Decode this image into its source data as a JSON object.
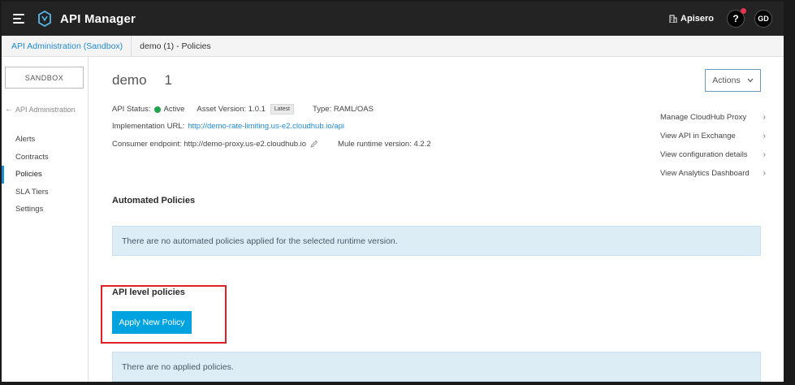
{
  "app": {
    "title": "API Manager",
    "org_name": "Apisero",
    "help_label": "?",
    "user_initials": "GD"
  },
  "breadcrumb": {
    "parent": "API Administration (Sandbox)",
    "current": "demo (1) - Policies"
  },
  "sidebar": {
    "environment": "SANDBOX",
    "back_label": "API Administration",
    "items": [
      {
        "label": "Alerts",
        "active": false
      },
      {
        "label": "Contracts",
        "active": false
      },
      {
        "label": "Policies",
        "active": true
      },
      {
        "label": "SLA Tiers",
        "active": false
      },
      {
        "label": "Settings",
        "active": false
      }
    ]
  },
  "api": {
    "name": "demo",
    "version": "1",
    "actions_label": "Actions",
    "status_label": "API Status:",
    "status_value": "Active",
    "asset_version_label": "Asset Version: 1.0.1",
    "asset_badge": "Latest",
    "type_label": "Type: RAML/OAS",
    "impl_url_label": "Implementation URL:",
    "impl_url": "http://demo-rate-limiting.us-e2.cloudhub.io/api",
    "consumer_label": "Consumer endpoint: http://demo-proxy.us-e2.cloudhub.io",
    "runtime_label": "Mule runtime version: 4.2.2"
  },
  "right_links": [
    "Manage CloudHub Proxy",
    "View API in Exchange",
    "View configuration details",
    "View Analytics Dashboard"
  ],
  "automated": {
    "title": "Automated Policies",
    "empty_message": "There are no automated policies applied for the selected runtime version."
  },
  "api_level": {
    "title": "API level policies",
    "apply_button": "Apply New Policy",
    "empty_message": "There are no applied policies."
  },
  "colors": {
    "accent": "#1f8ad6",
    "primary_button": "#00a2df",
    "status_active": "#22a34c",
    "highlight": "#e01f26",
    "topbar": "#232323"
  }
}
